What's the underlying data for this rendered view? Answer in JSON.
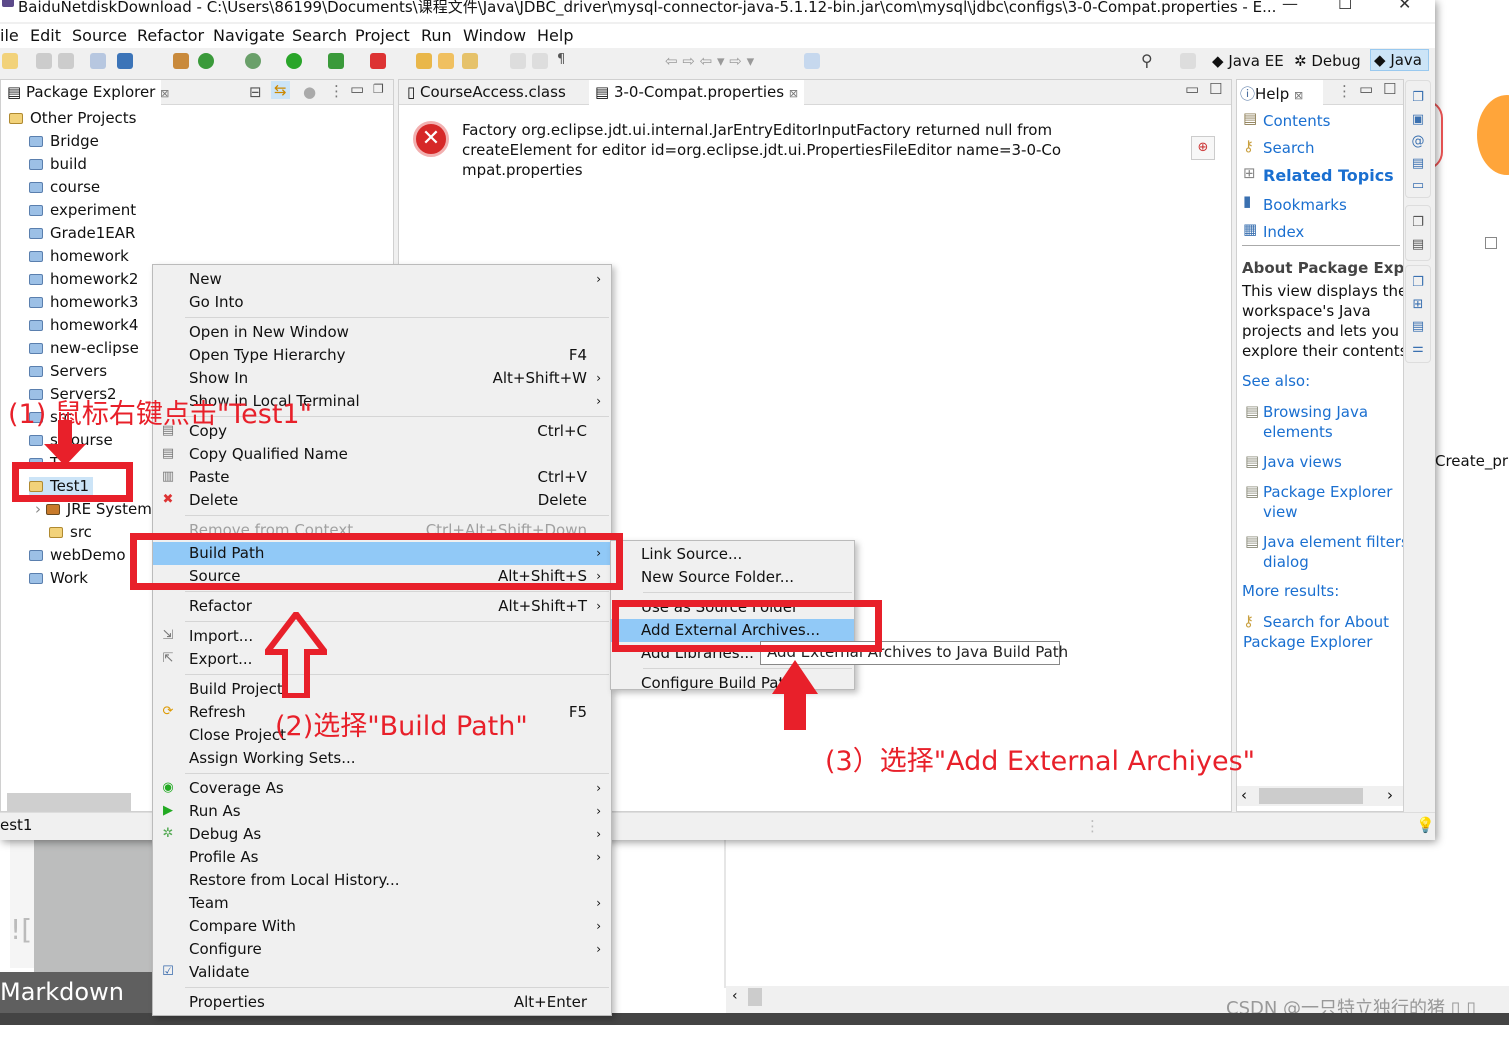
{
  "window": {
    "title": "BaiduNetdiskDownload - C:\\Users\\86199\\Documents\\课程文件\\Java\\JDBC_driver\\mysql-connector-java-5.1.12-bin.jar\\com\\mysql\\jdbc\\configs\\3-0-Compat.properties - E...",
    "minimize": "—",
    "maximize": "☐",
    "close": "✕"
  },
  "menubar": [
    "ile",
    "Edit",
    "Source",
    "Refactor",
    "Navigate",
    "Search",
    "Project",
    "Run",
    "Window",
    "Help"
  ],
  "perspectives": [
    "Java EE",
    "Debug",
    "Java"
  ],
  "package_explorer": {
    "title": "Package Explorer",
    "tree": [
      {
        "label": "Other Projects",
        "type": "working-set"
      },
      {
        "label": "Bridge"
      },
      {
        "label": "build"
      },
      {
        "label": "course"
      },
      {
        "label": "experiment"
      },
      {
        "label": "Grade1EAR"
      },
      {
        "label": "homework"
      },
      {
        "label": "homework2"
      },
      {
        "label": "homework3"
      },
      {
        "label": "homework4"
      },
      {
        "label": "new-eclipse"
      },
      {
        "label": "Servers"
      },
      {
        "label": "Servers2"
      },
      {
        "label": "src"
      },
      {
        "label": "s course"
      },
      {
        "label": "T"
      },
      {
        "label": "Test1",
        "selected": true,
        "type": "project"
      },
      {
        "label": "JRE System",
        "type": "library"
      },
      {
        "label": "src",
        "type": "package-folder"
      },
      {
        "label": "webDemo"
      },
      {
        "label": "Work"
      }
    ]
  },
  "editor": {
    "tabs": [
      "CourseAccess.class",
      "3-0-Compat.properties"
    ],
    "active_tab": 1,
    "error_message": "Factory org.eclipse.jdt.ui.internal.JarEntryEditorInputFactory returned null from createElement for editor id=org.eclipse.jdt.ui.PropertiesFileEditor name=3-0-Compat.properties"
  },
  "help": {
    "title": "Help",
    "links": [
      "Contents",
      "Search",
      "Related Topics",
      "Bookmarks",
      "Index"
    ],
    "about_heading": "About Package Explo",
    "about_text": "This view displays the workspace's Java projects and lets you explore their contents",
    "see_also": "See also:",
    "see_also_links": [
      "Browsing Java elements",
      "Java views",
      "Package Explorer view",
      "Java element filters dialog"
    ],
    "more_results": "More results:",
    "more_links": [
      "Search for About Package Explorer"
    ]
  },
  "context_menu": [
    {
      "label": "New",
      "arrow": true
    },
    {
      "label": "Go Into"
    },
    {
      "sep": true
    },
    {
      "label": "Open in New Window"
    },
    {
      "label": "Open Type Hierarchy",
      "shortcut": "F4"
    },
    {
      "label": "Show In",
      "shortcut": "Alt+Shift+W",
      "arrow": true
    },
    {
      "label": "Show in Local Terminal",
      "arrow": true
    },
    {
      "sep": true
    },
    {
      "label": "Copy",
      "shortcut": "Ctrl+C",
      "icon": "copy"
    },
    {
      "label": "Copy Qualified Name",
      "icon": "copy"
    },
    {
      "label": "Paste",
      "shortcut": "Ctrl+V",
      "icon": "paste"
    },
    {
      "label": "Delete",
      "shortcut": "Delete",
      "icon": "delete"
    },
    {
      "sep": true
    },
    {
      "label": "Remove from Context",
      "shortcut": "Ctrl+Alt+Shift+Down",
      "disabled": true
    },
    {
      "label": "Build Path",
      "arrow": true,
      "highlighted": true
    },
    {
      "label": "Source",
      "shortcut": "Alt+Shift+S",
      "arrow": true
    },
    {
      "sep": true
    },
    {
      "label": "Refactor",
      "shortcut": "Alt+Shift+T",
      "arrow": true
    },
    {
      "sep": true
    },
    {
      "label": "Import...",
      "icon": "import"
    },
    {
      "label": "Export...",
      "icon": "export"
    },
    {
      "sep": true
    },
    {
      "label": "Build Project"
    },
    {
      "label": "Refresh",
      "shortcut": "F5",
      "icon": "refresh"
    },
    {
      "label": "Close Project"
    },
    {
      "label": "Assign Working Sets..."
    },
    {
      "sep": true
    },
    {
      "label": "Coverage As",
      "arrow": true,
      "icon": "coverage"
    },
    {
      "label": "Run As",
      "arrow": true,
      "icon": "run"
    },
    {
      "label": "Debug As",
      "arrow": true,
      "icon": "debug"
    },
    {
      "label": "Profile As",
      "arrow": true
    },
    {
      "label": "Restore from Local History..."
    },
    {
      "label": "Team",
      "arrow": true
    },
    {
      "label": "Compare With",
      "arrow": true
    },
    {
      "label": "Configure",
      "arrow": true
    },
    {
      "label": "Validate",
      "icon": "check"
    },
    {
      "sep": true
    },
    {
      "label": "Properties",
      "shortcut": "Alt+Enter"
    }
  ],
  "build_path_submenu": [
    {
      "label": "Link Source..."
    },
    {
      "label": "New Source Folder..."
    },
    {
      "sep": true
    },
    {
      "label": "Use as Source Folder",
      "obscured": true
    },
    {
      "label": "Add External Archives...",
      "highlighted": true
    },
    {
      "label": "Add Libraries...",
      "obscured": true
    },
    {
      "sep": true
    },
    {
      "label": "Configure Build Path..."
    }
  ],
  "tooltip": "Add External Archives to Java Build Path",
  "status": {
    "selection": "est1"
  },
  "annotations": {
    "step1": "(1) 鼠标右键点击\"Test1\"",
    "step2": "(2)选择\"Build Path\"",
    "step3": "(3）选择\"Add External Archiyes\""
  },
  "background": {
    "markdown": "Markdown 巳",
    "bg_text": "Create_priv",
    "watermark": "CSDN @一只特立独行的猪 ▯ ▯"
  },
  "colors": {
    "highlight": "#91c9f7",
    "annotation": "#e8202a",
    "link": "#1a6fd0"
  }
}
